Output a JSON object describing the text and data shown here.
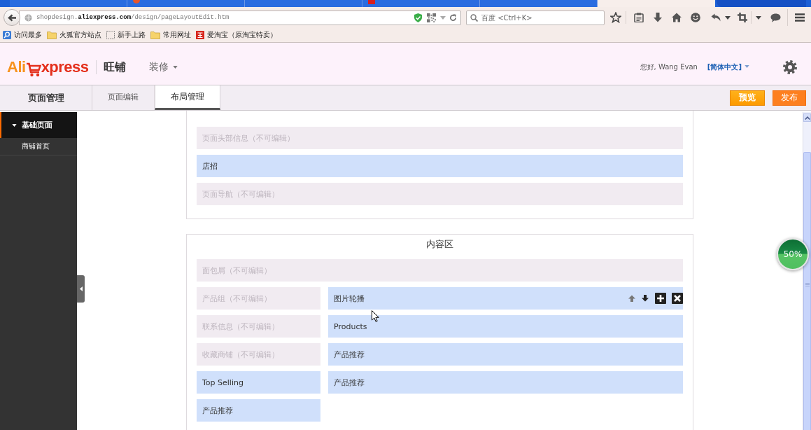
{
  "browser": {
    "tabs": [
      {
        "kind": "plain",
        "selected": false
      },
      {
        "kind": "round",
        "selected": false
      },
      {
        "kind": "plain",
        "selected": false
      },
      {
        "kind": "square",
        "selected": false
      },
      {
        "kind": "plain",
        "selected": false
      },
      {
        "kind": "plain",
        "selected": true
      }
    ],
    "address": "shopdesign.**aliexpress.com**/design/pageLayoutEdit.htm",
    "search": {
      "placeholder": "百度 <Ctrl+K>"
    },
    "bookmarks": [
      {
        "kind": "smart",
        "label": "访问最多"
      },
      {
        "kind": "folder",
        "label": "火狐官方站点"
      },
      {
        "kind": "page",
        "label": "新手上路"
      },
      {
        "kind": "folder",
        "label": "常用网址"
      },
      {
        "kind": "site",
        "label": "爱淘宝（原淘宝特卖）"
      }
    ]
  },
  "header": {
    "logo": {
      "left": "Ali",
      "right": "xpress"
    },
    "product": "旺铺",
    "menu": "装修",
    "greeting": "您好, Wang Evan",
    "language": "[简体中文]"
  },
  "toolbar": {
    "title": "页面管理",
    "tabs": [
      {
        "label": "页面编辑",
        "selected": false
      },
      {
        "label": "布局管理",
        "selected": true
      }
    ],
    "buttons": [
      {
        "kind": "preview",
        "label": "预览"
      },
      {
        "kind": "publish",
        "label": "发布"
      }
    ]
  },
  "sidebar": {
    "groups": [
      {
        "label": "基础页面",
        "expanded": true,
        "children": [
          {
            "label": "商铺首页"
          }
        ]
      }
    ]
  },
  "layout": {
    "header_section": {
      "modules": [
        {
          "label": "页面头部信息（不可编辑）",
          "editable": false
        },
        {
          "label": "店招",
          "editable": true
        },
        {
          "label": "页面导航（不可编辑）",
          "editable": false
        }
      ]
    },
    "content_section": {
      "title": "内容区",
      "full_width": [
        {
          "label": "面包屑（不可编辑）",
          "editable": false
        }
      ],
      "left_column": [
        {
          "label": "产品组（不可编辑）",
          "editable": false
        },
        {
          "label": "联系信息（不可编辑）",
          "editable": false
        },
        {
          "label": "收藏商铺（不可编辑）",
          "editable": false
        },
        {
          "label": "Top Selling",
          "editable": true
        },
        {
          "label": "产品推荐",
          "editable": true
        }
      ],
      "right_column": [
        {
          "label": "图片轮播",
          "editable": true,
          "hovered": true
        },
        {
          "label": "Products",
          "editable": true,
          "hovered": false
        },
        {
          "label": "产品推荐",
          "editable": true,
          "hovered": false
        },
        {
          "label": "产品推荐",
          "editable": true,
          "hovered": false
        }
      ]
    }
  },
  "percent_badge": {
    "label": "50%"
  }
}
